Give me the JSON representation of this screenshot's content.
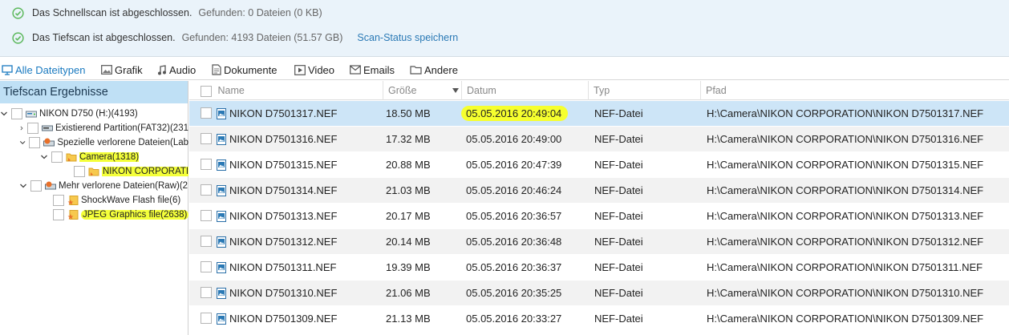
{
  "status": {
    "quick": {
      "text": "Das Schnellscan ist abgeschlossen.",
      "found": "Gefunden: 0 Dateien (0 KB)"
    },
    "deep": {
      "text": "Das Tiefscan ist abgeschlossen.",
      "found": "Gefunden: 4193 Dateien (51.57 GB)",
      "link": "Scan-Status speichern"
    },
    "icon": "check-circle-icon",
    "accent": "#5cb85c"
  },
  "tabs": [
    {
      "label": "Alle Dateitypen",
      "icon": "monitor-icon",
      "active": true
    },
    {
      "label": "Grafik",
      "icon": "image-icon"
    },
    {
      "label": "Audio",
      "icon": "music-icon"
    },
    {
      "label": "Dokumente",
      "icon": "document-icon"
    },
    {
      "label": "Video",
      "icon": "video-icon"
    },
    {
      "label": "Emails",
      "icon": "mail-icon"
    },
    {
      "label": "Andere",
      "icon": "folder-icon"
    }
  ],
  "tree": {
    "title": "Tiefscan Ergebnisse",
    "items": [
      {
        "label": "NIKON D750 (H:)(4193)",
        "icon": "drive-icon"
      },
      {
        "label": "Existierend Partition(FAT32)(231",
        "icon": "partition-icon"
      },
      {
        "label": "Spezielle verlorene Dateien(Lab",
        "icon": "lost-files-icon"
      },
      {
        "label": "Camera(1318)",
        "icon": "folder-icon"
      },
      {
        "label": "NIKON CORPORATIO",
        "icon": "folder-icon"
      },
      {
        "label": "Mehr verlorene Dateien(Raw)(2",
        "icon": "raw-files-icon"
      },
      {
        "label": "ShockWave Flash file(6)",
        "icon": "star-file-icon"
      },
      {
        "label": "JPEG Graphics file(2638)",
        "icon": "star-file-icon"
      }
    ]
  },
  "grid": {
    "columns": {
      "name": "Name",
      "size": "Größe",
      "date": "Datum",
      "type": "Typ",
      "path": "Pfad"
    },
    "rows": [
      {
        "name": "NIKON D7501317.NEF",
        "size": "18.50 MB",
        "date": "05.05.2016 20:49:04",
        "type": "NEF-Datei",
        "path": "H:\\Camera\\NIKON CORPORATION\\NIKON D7501317.NEF"
      },
      {
        "name": "NIKON D7501316.NEF",
        "size": "17.32 MB",
        "date": "05.05.2016 20:49:00",
        "type": "NEF-Datei",
        "path": "H:\\Camera\\NIKON CORPORATION\\NIKON D7501316.NEF"
      },
      {
        "name": "NIKON D7501315.NEF",
        "size": "20.88 MB",
        "date": "05.05.2016 20:47:39",
        "type": "NEF-Datei",
        "path": "H:\\Camera\\NIKON CORPORATION\\NIKON D7501315.NEF"
      },
      {
        "name": "NIKON D7501314.NEF",
        "size": "21.03 MB",
        "date": "05.05.2016 20:46:24",
        "type": "NEF-Datei",
        "path": "H:\\Camera\\NIKON CORPORATION\\NIKON D7501314.NEF"
      },
      {
        "name": "NIKON D7501313.NEF",
        "size": "20.17 MB",
        "date": "05.05.2016 20:36:57",
        "type": "NEF-Datei",
        "path": "H:\\Camera\\NIKON CORPORATION\\NIKON D7501313.NEF"
      },
      {
        "name": "NIKON D7501312.NEF",
        "size": "20.14 MB",
        "date": "05.05.2016 20:36:48",
        "type": "NEF-Datei",
        "path": "H:\\Camera\\NIKON CORPORATION\\NIKON D7501312.NEF"
      },
      {
        "name": "NIKON D7501311.NEF",
        "size": "19.39 MB",
        "date": "05.05.2016 20:36:37",
        "type": "NEF-Datei",
        "path": "H:\\Camera\\NIKON CORPORATION\\NIKON D7501311.NEF"
      },
      {
        "name": "NIKON D7501310.NEF",
        "size": "21.06 MB",
        "date": "05.05.2016 20:35:25",
        "type": "NEF-Datei",
        "path": "H:\\Camera\\NIKON CORPORATION\\NIKON D7501310.NEF"
      },
      {
        "name": "NIKON D7501309.NEF",
        "size": "21.13 MB",
        "date": "05.05.2016 20:33:27",
        "type": "NEF-Datei",
        "path": "H:\\Camera\\NIKON CORPORATION\\NIKON D7501309.NEF"
      }
    ]
  },
  "colors": {
    "selected_row": "#cde5f7",
    "highlighter": "#f6ff2e",
    "tab_active": "#1a7ac0"
  }
}
